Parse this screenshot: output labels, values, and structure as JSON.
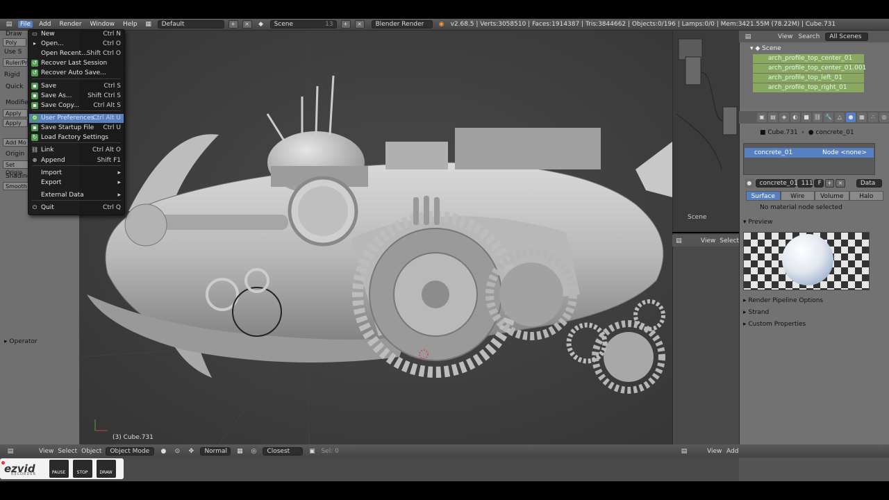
{
  "topbar": {
    "menus": [
      "File",
      "Add",
      "Render",
      "Window",
      "Help"
    ],
    "layout": "Default",
    "scene": "Scene",
    "scene_users": "13",
    "engine": "Blender Render",
    "stats": "v2.68.5 | Verts:3058510 | Faces:1914387 | Tris:3844662 | Objects:0/196 | Lamps:0/0 | Mem:3421.55M (78.22M) | Cube.731"
  },
  "file_menu": {
    "items": [
      {
        "label": "New",
        "shortcut": "Ctrl N",
        "icon": "new-file-icon"
      },
      {
        "label": "Open...",
        "shortcut": "Ctrl O",
        "icon": "open-folder-icon"
      },
      {
        "label": "Open Recent...",
        "shortcut": "Shift Ctrl O",
        "icon": "",
        "submenu": true
      },
      {
        "label": "Recover Last Session",
        "shortcut": "",
        "icon": "recover-icon"
      },
      {
        "label": "Recover Auto Save...",
        "shortcut": "",
        "icon": "recover-icon"
      },
      {
        "label": "Save",
        "shortcut": "Ctrl S",
        "icon": "save-icon"
      },
      {
        "label": "Save As...",
        "shortcut": "Shift Ctrl S",
        "icon": "save-icon"
      },
      {
        "label": "Save Copy...",
        "shortcut": "Ctrl Alt S",
        "icon": "save-icon"
      },
      {
        "label": "User Preferences...",
        "shortcut": "Ctrl Alt U",
        "icon": "preferences-icon"
      },
      {
        "label": "Save Startup File",
        "shortcut": "Ctrl U",
        "icon": "save-icon"
      },
      {
        "label": "Load Factory Settings",
        "shortcut": "",
        "icon": "load-icon"
      },
      {
        "label": "Link",
        "shortcut": "Ctrl Alt O",
        "icon": "link-icon"
      },
      {
        "label": "Append",
        "shortcut": "Shift F1",
        "icon": "append-icon"
      },
      {
        "label": "Import",
        "shortcut": "",
        "icon": "",
        "submenu": true
      },
      {
        "label": "Export",
        "shortcut": "",
        "icon": "",
        "submenu": true
      },
      {
        "label": "External Data",
        "shortcut": "",
        "icon": "",
        "submenu": true
      },
      {
        "label": "Quit",
        "shortcut": "Ctrl Q",
        "icon": "quit-icon"
      }
    ],
    "highlighted_label": "User Preferences..."
  },
  "toolshelf": {
    "rows": [
      "Draw",
      "Poly",
      "Use S",
      "Ruler/Pr",
      "Rigid",
      "Quick",
      "Modifier",
      "Apply",
      "Apply",
      "Add Mo",
      "Origin",
      "Set Origin",
      "Shading",
      "Smooth"
    ],
    "operator": "Operator"
  },
  "viewport": {
    "object_label": "(3) Cube.731"
  },
  "nodes": {
    "scene_label": "Scene"
  },
  "lower_mid": {
    "view": "View",
    "select": "Select"
  },
  "outliner": {
    "view": "View",
    "search": "Search",
    "filter": "All Scenes",
    "scene": "Scene",
    "items": [
      "arch_profile_top_center_01",
      "arch_profile_top_center_01.001",
      "arch_profile_top_left_01",
      "arch_profile_top_right_01"
    ]
  },
  "properties": {
    "breadcrumb_object": "Cube.731",
    "breadcrumb_material": "concrete_01",
    "material_slot": "concrete_01",
    "node_field": "Node <none>",
    "material_name": "concrete_01",
    "user_count": "111",
    "fake_user": "F",
    "data_label": "Data",
    "tabs": [
      "Surface",
      "Wire",
      "Volume",
      "Halo"
    ],
    "active_tab": "Surface",
    "no_node_msg": "No material node selected",
    "preview_label": "Preview",
    "sections": [
      "Render Pipeline Options",
      "Strand",
      "Custom Properties"
    ]
  },
  "bottombar": {
    "view": "View",
    "select": "Select",
    "object": "Object",
    "mode": "Object Mode",
    "pivot": "Normal",
    "snap": "Closest",
    "sel": "Sel: 0",
    "right_view": "View",
    "right_add": "Add"
  },
  "recorder": {
    "logo": "ezvid",
    "sub": "RECORDER",
    "buttons": [
      "PAUSE",
      "STOP",
      "DRAW"
    ]
  },
  "colors": {
    "highlight": "#5680c2",
    "outliner_selected": "#8aa860",
    "panel": "#727272"
  }
}
